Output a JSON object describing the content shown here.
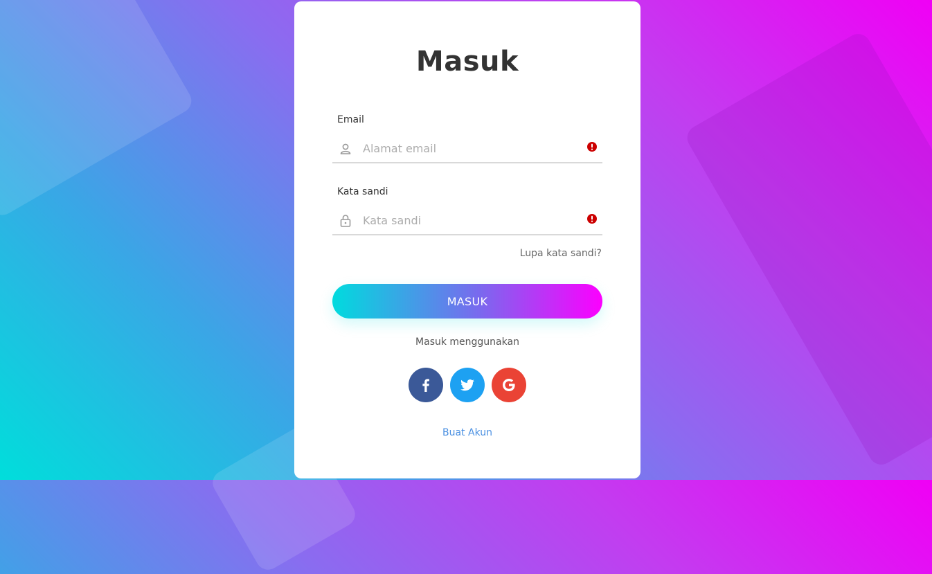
{
  "colors": {
    "accent_start": "#00dbde",
    "accent_end": "#fc00ff",
    "alert": "#cc0000",
    "link": "#4a90e2"
  },
  "form": {
    "title": "Masuk",
    "email": {
      "label": "Email",
      "placeholder": "Alamat email",
      "icon": "user-icon"
    },
    "password": {
      "label": "Kata sandi",
      "placeholder": "Kata sandi",
      "icon": "lock-icon"
    },
    "forgot_link": "Lupa kata sandi?",
    "submit_label": "MASUK",
    "alt_login_text": "Masuk menggunakan",
    "socials": [
      "facebook-icon",
      "twitter-icon",
      "google-icon"
    ],
    "signup_link": "Buat Akun"
  }
}
